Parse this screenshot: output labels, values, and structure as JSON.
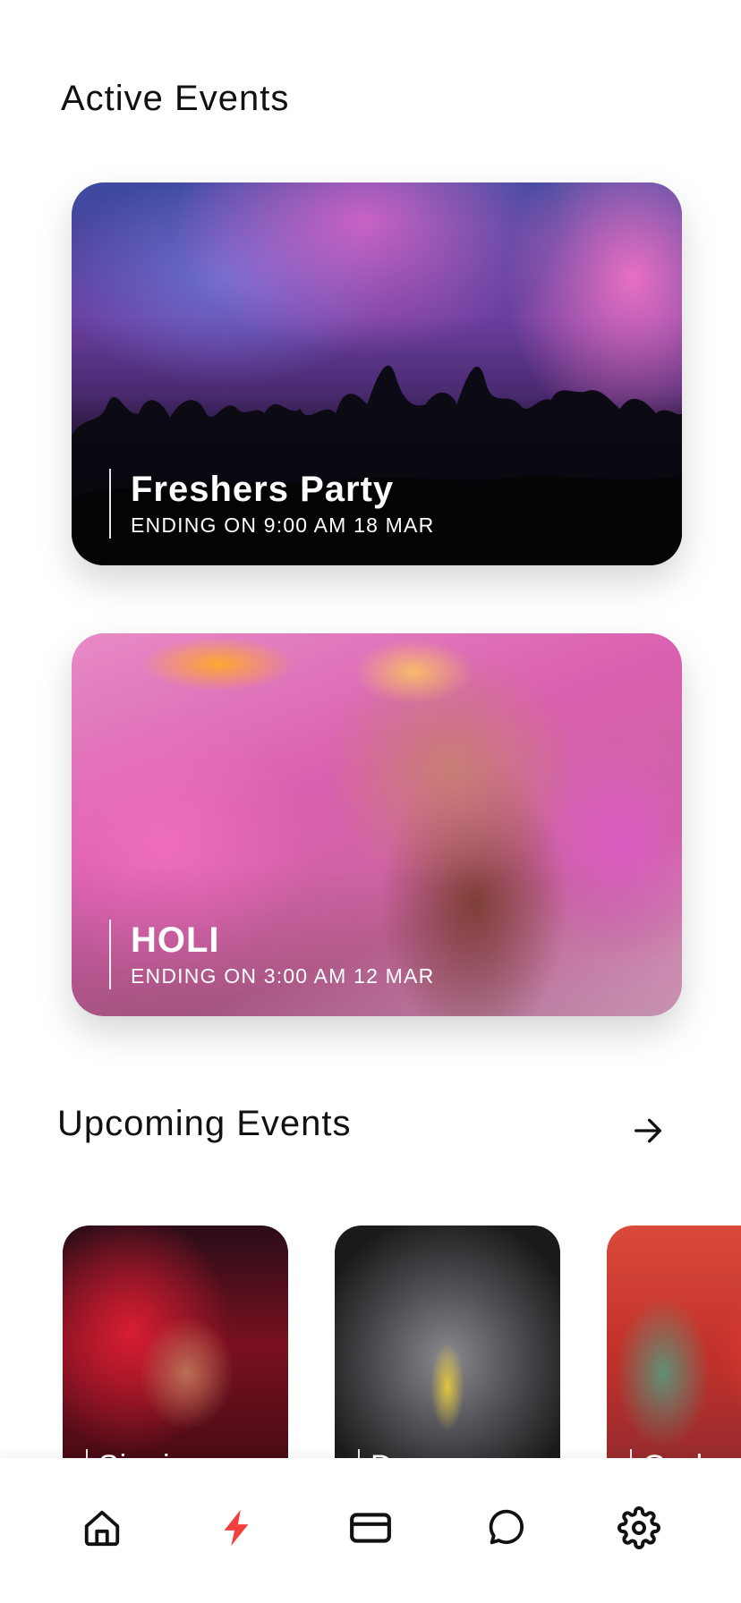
{
  "sections": {
    "active_title": "Active Events",
    "upcoming_title": "Upcoming Events"
  },
  "active_events": [
    {
      "name": "Freshers Party",
      "ending": "ENDING ON 9:00 AM 18 MAR"
    },
    {
      "name": "HOLI",
      "ending": "ENDING ON 3:00 AM 12 MAR"
    }
  ],
  "upcoming_events": [
    {
      "label": "Singing"
    },
    {
      "label": "Dance"
    },
    {
      "label": "Garba"
    }
  ],
  "nav": {
    "items": [
      {
        "icon": "home-icon",
        "active": false
      },
      {
        "icon": "lightning-icon",
        "active": true
      },
      {
        "icon": "card-icon",
        "active": false
      },
      {
        "icon": "chat-icon",
        "active": false
      },
      {
        "icon": "gear-icon",
        "active": false
      }
    ],
    "active_color": "#f2403c",
    "icon_color": "#111111"
  },
  "icons": {
    "see_all": "arrow-right-icon"
  }
}
